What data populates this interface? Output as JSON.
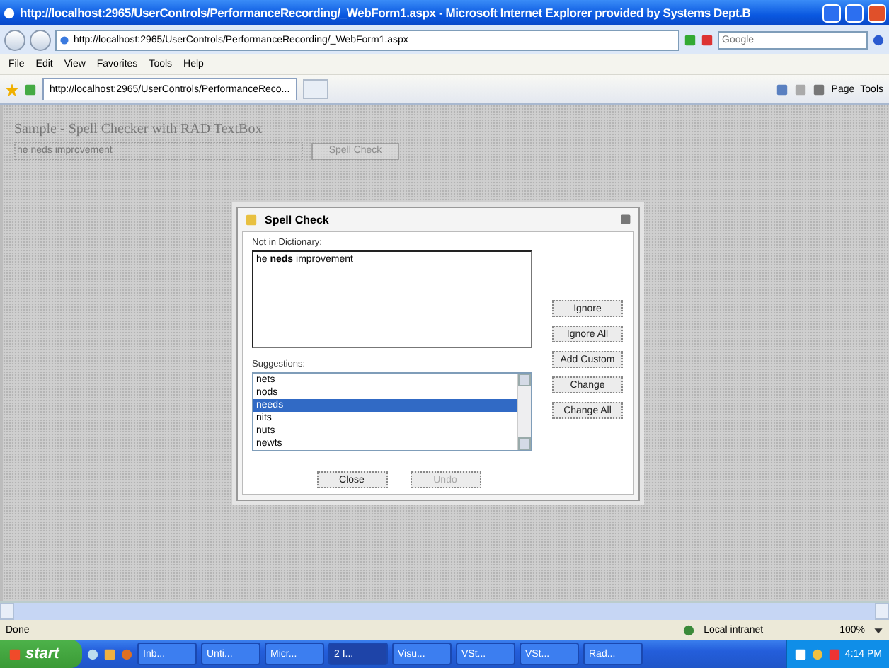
{
  "window": {
    "title": "http://localhost:2965/UserControls/PerformanceRecording/_WebForm1.aspx - Microsoft Internet Explorer provided by Systems Dept.B"
  },
  "address_bar": {
    "value": "http://localhost:2965/UserControls/PerformanceRecording/_WebForm1.aspx"
  },
  "search": {
    "placeholder": "Google"
  },
  "menu": [
    "File",
    "Edit",
    "View",
    "Favorites",
    "Tools",
    "Help"
  ],
  "tabs": [
    {
      "label": "http://localhost:2965/UserControls/PerformanceReco...",
      "selected": true
    }
  ],
  "command_bar": [
    {
      "label": "Page"
    },
    {
      "label": "Tools"
    }
  ],
  "page": {
    "heading": "Sample - Spell Checker with RAD TextBox",
    "textbox": {
      "value": "he neds improvement"
    },
    "button": "Spell Check"
  },
  "dialog": {
    "title": "Spell Check",
    "not_in_dictionary_label": "Not in Dictionary:",
    "not_in_dictionary_text": "he **neds** improvement",
    "suggestions_label": "Suggestions:",
    "suggestions": [
      {
        "label": "nets",
        "selected": false
      },
      {
        "label": "nods",
        "selected": false
      },
      {
        "label": "needs",
        "selected": true
      },
      {
        "label": "nits",
        "selected": false
      },
      {
        "label": "nuts",
        "selected": false
      },
      {
        "label": "newts",
        "selected": false
      }
    ],
    "side_buttons": [
      {
        "label": "Ignore",
        "disabled": false
      },
      {
        "label": "Ignore All",
        "disabled": false
      },
      {
        "label": "Add Custom",
        "disabled": false
      },
      {
        "label": "Change",
        "disabled": false
      },
      {
        "label": "Change All",
        "disabled": false
      }
    ],
    "bottom_buttons": [
      {
        "label": "Close",
        "disabled": false
      },
      {
        "label": "Undo",
        "disabled": true
      }
    ]
  },
  "status_bar": {
    "status": "Done",
    "zone": "Local intranet",
    "zoom": "100%"
  },
  "taskbar": {
    "start": "start",
    "items": [
      {
        "label": "Inb...",
        "selected": false
      },
      {
        "label": "Unti...",
        "selected": false
      },
      {
        "label": "Micr...",
        "selected": false
      },
      {
        "label": "2 I...",
        "selected": true
      },
      {
        "label": "Visu...",
        "selected": false
      },
      {
        "label": "VSt...",
        "selected": false
      },
      {
        "label": "VSt...",
        "selected": false
      },
      {
        "label": "Rad...",
        "selected": false
      }
    ],
    "clock": "4:14 PM"
  }
}
